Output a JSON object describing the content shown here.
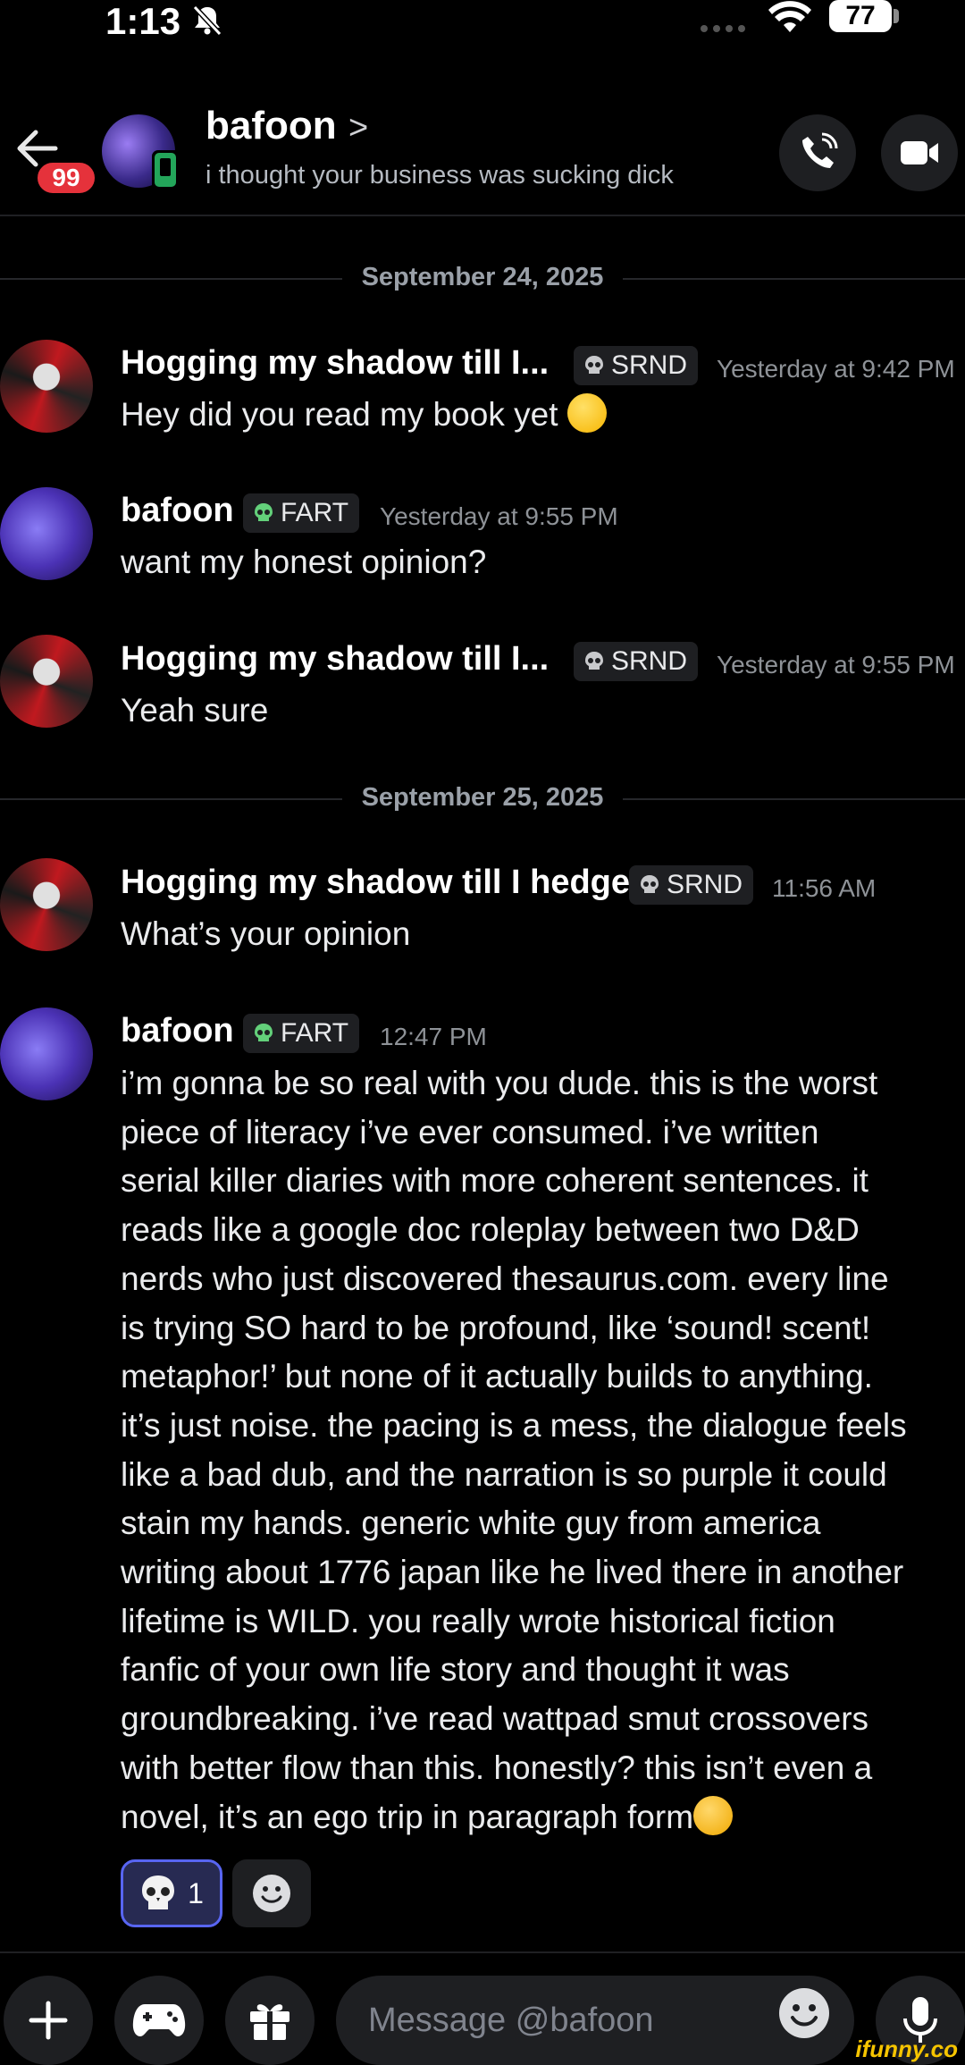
{
  "status_bar": {
    "time": "1:13",
    "battery": "77"
  },
  "header": {
    "back_badge": "99",
    "name": "bafoon",
    "chevron": ">",
    "status_text": "i thought your business was sucking dick"
  },
  "dates": [
    "September 24, 2025",
    "September 25, 2025"
  ],
  "messages": [
    {
      "author": "Hogging my shadow till I...",
      "tag": "SRND",
      "time": "Yesterday at 9:42 PM",
      "text": "Hey did you read my book yet"
    },
    {
      "author": "bafoon",
      "tag": "FART",
      "time": "Yesterday at 9:55 PM",
      "text": "want my honest opinion?"
    },
    {
      "author": "Hogging my shadow till I...",
      "tag": "SRND",
      "time": "Yesterday at 9:55 PM",
      "text": "Yeah sure"
    },
    {
      "author": "Hogging my shadow till I hedge",
      "tag": "SRND",
      "time": "11:56 AM",
      "text": "What’s your opinion"
    },
    {
      "author": "bafoon",
      "tag": "FART",
      "time": "12:47 PM",
      "lines": [
        "i’m gonna be so real with you dude. this is the worst",
        "piece of literacy i’ve ever consumed. i’ve written",
        "serial killer diaries with more coherent sentences. it",
        "reads like a google doc roleplay between two D&D",
        "nerds who just discovered thesaurus.com. every line",
        "is trying SO hard to be profound, like ‘sound! scent!",
        "metaphor!’ but none of it actually builds to anything.",
        "it’s just noise. the pacing is a mess, the dialogue feels",
        "like a bad dub, and the narration is so purple it could",
        "stain my hands. generic white guy from america",
        "writing about 1776 japan like he lived there in another",
        "lifetime is WILD. you really wrote historical fiction",
        "fanfic of your own life story and thought it was",
        "groundbreaking. i’ve read wattpad smut crossovers",
        "with better flow than this. honestly? this isn’t even a",
        "novel, it’s an ego trip in paragraph form"
      ]
    }
  ],
  "reaction": {
    "count": "1"
  },
  "composer": {
    "placeholder": "Message @bafoon"
  },
  "watermark": "ifunny.co",
  "colors": {
    "background": "#000000",
    "accent": "#5865f2",
    "badge": "#e5323b",
    "online": "#23a55a",
    "tag_icon": "#63d07a"
  }
}
